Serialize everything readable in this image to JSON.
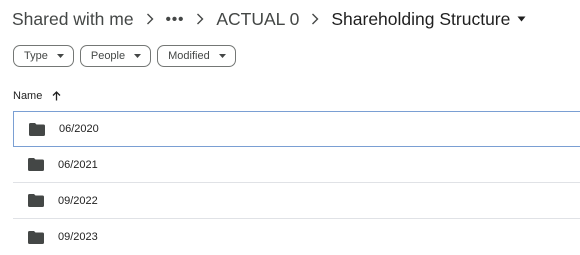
{
  "breadcrumb": {
    "root": "Shared with me",
    "overflow": "•••",
    "parent": "ACTUAL 0",
    "current": "Shareholding Structure",
    "separator_icon": "chevron-right-icon",
    "current_menu_icon": "arrow-drop-down-icon"
  },
  "filters": {
    "type": "Type",
    "people": "People",
    "modified": "Modified"
  },
  "list": {
    "column_name": "Name",
    "sort_icon": "arrow-upward-icon",
    "rows": [
      {
        "name": "06/2020",
        "icon": "folder-icon",
        "selected": true
      },
      {
        "name": "06/2021",
        "icon": "folder-icon",
        "selected": false
      },
      {
        "name": "09/2022",
        "icon": "folder-icon",
        "selected": false
      },
      {
        "name": "09/2023",
        "icon": "folder-icon",
        "selected": false
      }
    ]
  },
  "colors": {
    "text": "#1f1f1f",
    "muted": "#444746",
    "chip_border": "#747775",
    "selected_border": "#7a9fd3",
    "divider": "#e0e2e6"
  }
}
